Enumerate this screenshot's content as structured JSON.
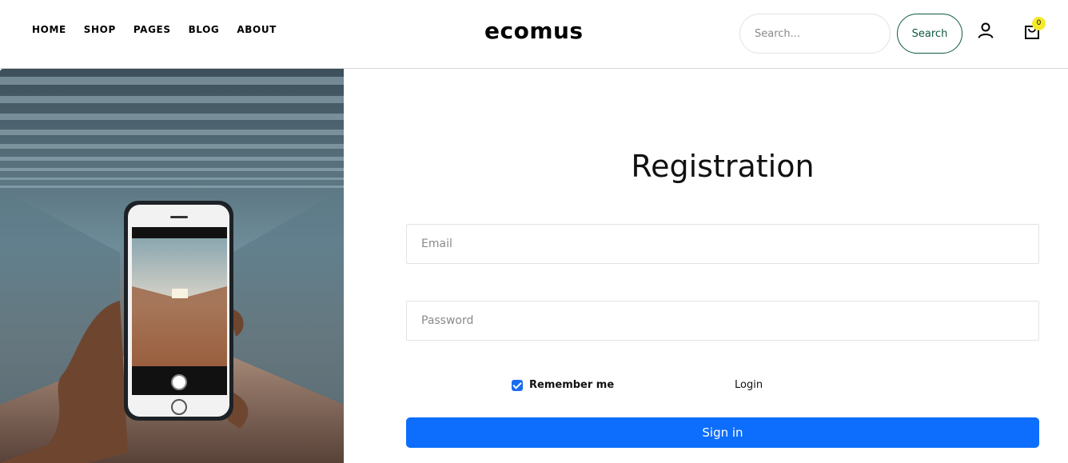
{
  "nav": {
    "items": [
      {
        "label": "HOME"
      },
      {
        "label": "SHOP"
      },
      {
        "label": "PAGES"
      },
      {
        "label": "BLOG"
      },
      {
        "label": "ABOUT"
      }
    ]
  },
  "logo": {
    "text": "ecomus"
  },
  "search": {
    "placeholder": "Search...",
    "button_label": "Search"
  },
  "cart": {
    "count": "0"
  },
  "form": {
    "title": "Registration",
    "email_placeholder": "Email",
    "password_placeholder": "Password",
    "remember_label": "Remember me",
    "login_link": "Login",
    "submit_label": "Sign in"
  },
  "colors": {
    "accent": "#0d6efd",
    "search_border": "#0f5a3e",
    "badge": "#f5ea2a"
  },
  "icons": {
    "user": "user-icon",
    "cart": "cart-icon",
    "checkbox": "checkbox-checked-icon"
  }
}
